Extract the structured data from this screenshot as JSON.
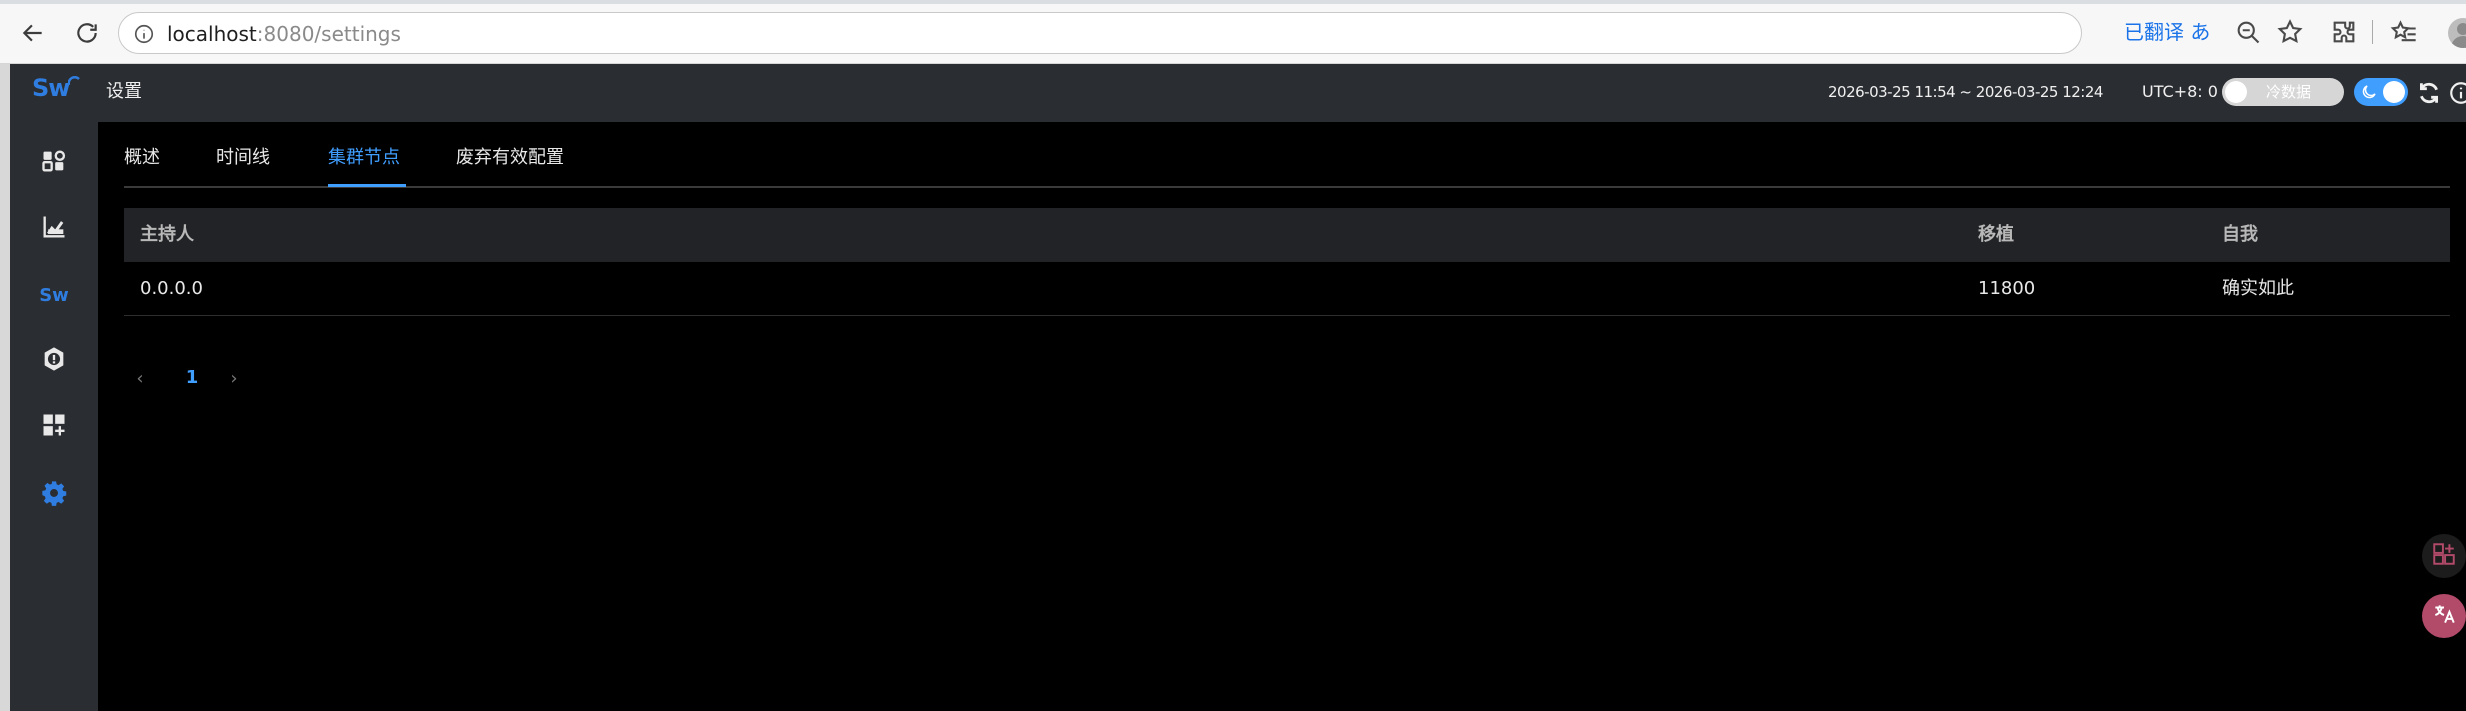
{
  "browser": {
    "url_host": "localhost",
    "url_rest": ":8080/settings",
    "translated_label": "已翻译 ",
    "translate_glyph": "あ",
    "icons": [
      "back-arrow-icon",
      "reload-icon",
      "info-icon",
      "zoom-out-icon",
      "star-icon",
      "extensions-icon",
      "favorites-icon",
      "avatar"
    ]
  },
  "sidebar": {
    "logo_text": "Sw",
    "items": [
      {
        "name": "dashboard-icon"
      },
      {
        "name": "chart-icon"
      },
      {
        "name": "skywalking-icon",
        "label": "Sw"
      },
      {
        "name": "alert-shield-icon"
      },
      {
        "name": "add-widget-icon"
      },
      {
        "name": "settings-gear-icon",
        "active": true
      }
    ]
  },
  "header": {
    "title": "设置",
    "time_range": "2026-03-25 11:54 ~ 2026-03-25 12:24",
    "utc_label": "UTC+8:",
    "utc_value": "0",
    "cold_data_label": "冷数据",
    "colors": {
      "accent": "#409eff",
      "bar": "#2a2d31"
    }
  },
  "tabs": [
    {
      "label": "概述",
      "active": false
    },
    {
      "label": "时间线",
      "active": false
    },
    {
      "label": "集群节点",
      "active": true
    },
    {
      "label": "废弃有效配置",
      "active": false
    }
  ],
  "table": {
    "columns": [
      "主持人",
      "移植",
      "自我"
    ],
    "rows": [
      [
        "0.0.0.0",
        "11800",
        "确实如此"
      ]
    ]
  },
  "pagination": {
    "prev": "‹",
    "current": "1",
    "next": "›"
  }
}
